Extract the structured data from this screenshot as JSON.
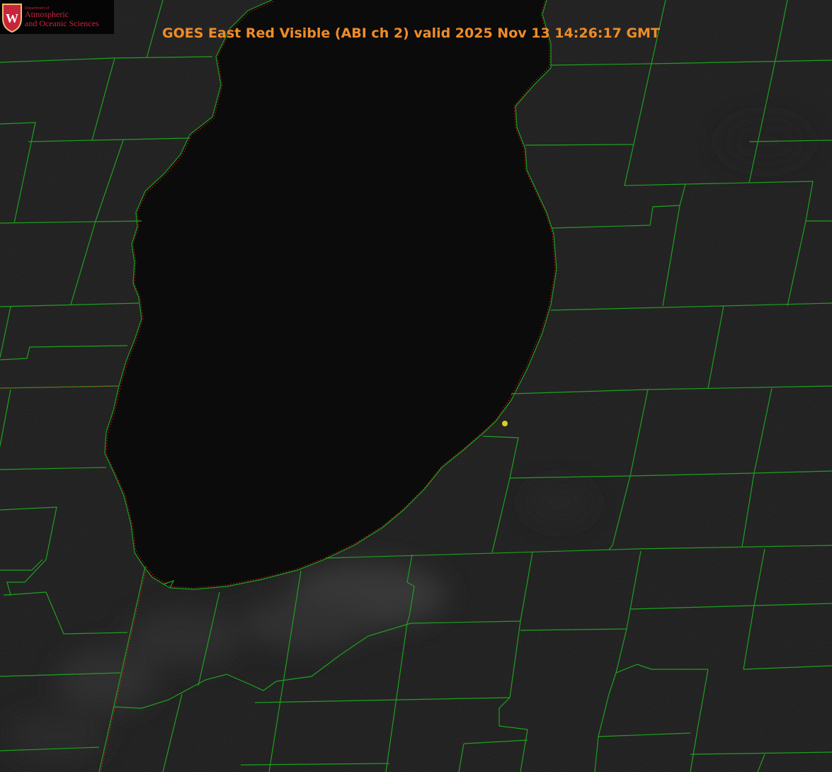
{
  "title": "GOES East Red Visible (ABI ch 2) valid 2025 Nov 13 14:26:17 GMT",
  "logo": {
    "department": "Department of",
    "line1": "Atmospheric",
    "line2": "and Oceanic Sciences",
    "crest_letter": "W"
  },
  "colors": {
    "background": "#161616",
    "lake": "#0b0b0b",
    "county_lines": "#1fa01f",
    "shoreline_dotted": "#e01818",
    "title": "#f08c28",
    "marker": "#d8d020",
    "logo_text": "#c8243c"
  },
  "icons": {
    "crest": "uw-crest-icon",
    "marker": "location-marker-icon"
  }
}
